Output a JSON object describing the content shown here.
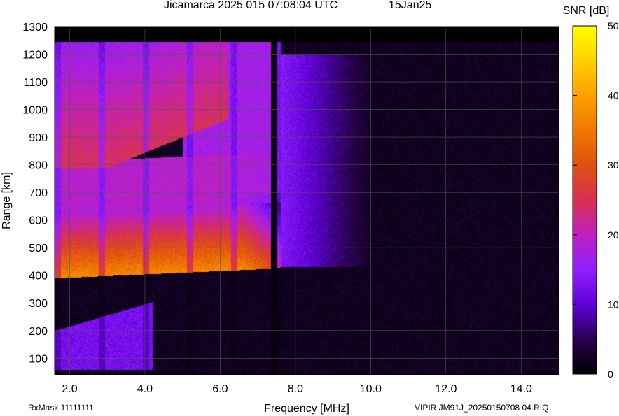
{
  "title": {
    "station": "Jicamarca 2025 015 07:08:04 UTC",
    "date": "15Jan25"
  },
  "colorbar": {
    "label": "SNR [dB]",
    "ticks": [
      "50",
      "40",
      "30",
      "20",
      "10",
      "0"
    ],
    "range": [
      0,
      50
    ],
    "colors": [
      "#000000",
      "#3a0080",
      "#7a00ff",
      "#a43cff",
      "#d01060",
      "#e06000",
      "#ff9e00",
      "#ffe000",
      "#ffff00"
    ]
  },
  "footer": {
    "left": "RxMask 11111111",
    "right": "VIPIR  JM91J_20250150708 04.RIQ"
  },
  "chart_data": {
    "type": "heatmap",
    "title": "Jicamarca 2025 015 07:08:04 UTC 15Jan25",
    "xlabel": "Frequency [MHz]",
    "ylabel": "Range [km]",
    "xlim": [
      1.6,
      15.0
    ],
    "ylim": [
      40,
      1300
    ],
    "xticks": [
      "2.0",
      "4.0",
      "6.0",
      "8.0",
      "10.0",
      "12.0",
      "14.0"
    ],
    "yticks": [
      "100",
      "200",
      "300",
      "400",
      "500",
      "600",
      "700",
      "800",
      "900",
      "1000",
      "1100",
      "1200",
      "1300"
    ],
    "colorbar_label": "SNR [dB]",
    "colorbar_range": [
      0,
      50
    ],
    "grid": true,
    "echo_traces": [
      {
        "name": "",
        "x": [
          1.6,
          2.0,
          3.0,
          4.0,
          5.0,
          6.0,
          7.0,
          7.5
        ],
        "y": [
          390,
          392,
          396,
          400,
          408,
          418,
          430,
          440
        ],
        "peak_snr_db": 37
      },
      {
        "name": "",
        "x": [
          1.6,
          2.0,
          3.0,
          4.0,
          5.0,
          5.5
        ],
        "y": [
          790,
          795,
          805,
          830,
          880,
          950
        ],
        "peak_snr_db": 30
      },
      {
        "name": "",
        "x": [
          1.6,
          2.0,
          3.0,
          4.0
        ],
        "y": [
          70,
          80,
          120,
          180
        ],
        "peak_snr_db": 14
      }
    ]
  }
}
